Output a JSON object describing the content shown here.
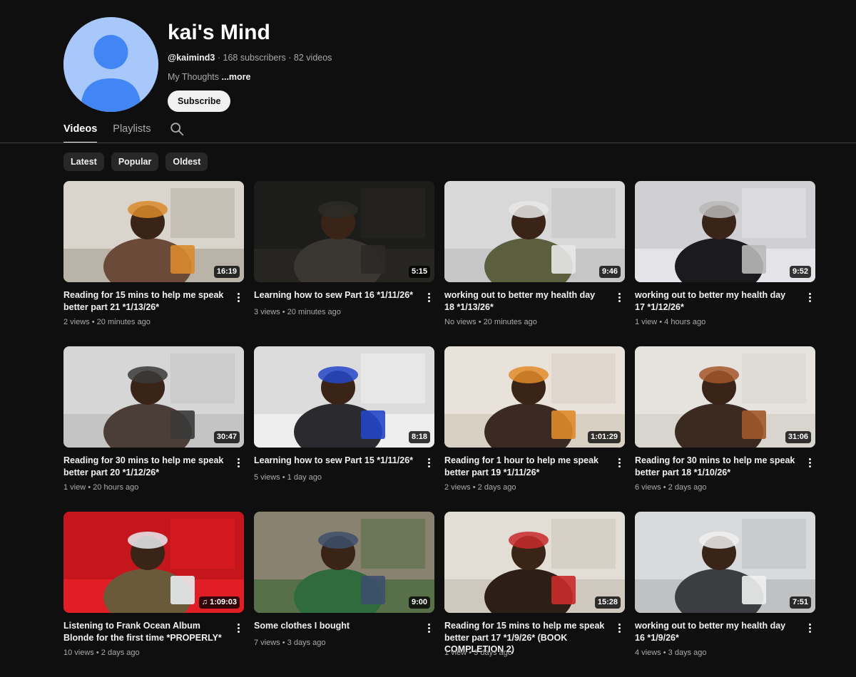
{
  "channel": {
    "title": "kai's Mind",
    "handle": "@kaimind3",
    "subscribers": "168 subscribers",
    "videos_count": "82 videos",
    "separator": "·",
    "description": "My Thoughts",
    "more_label": "...more",
    "subscribe_label": "Subscribe",
    "avatar_icon": "default-person-avatar",
    "avatar_bg": "#a8c7fa",
    "avatar_fg": "#4285f4"
  },
  "tabs": [
    {
      "label": "Videos",
      "active": true
    },
    {
      "label": "Playlists",
      "active": false
    }
  ],
  "search_icon": "search-icon",
  "chips": [
    "Latest",
    "Popular",
    "Oldest"
  ],
  "videos": [
    {
      "title": "Reading for 15 mins to help me speak better part 21 *1/13/26*",
      "duration": "16:19",
      "views": "2 views",
      "age": "20 minutes ago",
      "palette": [
        "#d9d4cc",
        "#b9b3a8",
        "#6b4a3a",
        "#d98a2b"
      ]
    },
    {
      "title": "Learning how to sew Part 16 *1/11/26*",
      "duration": "5:15",
      "views": "3 views",
      "age": "20 minutes ago",
      "palette": [
        "#1c1c1a",
        "#262522",
        "#3a3732",
        "#2c2a26"
      ]
    },
    {
      "title": "working out to better my health day 18 *1/13/26*",
      "duration": "9:46",
      "views": "No views",
      "age": "20 minutes ago",
      "palette": [
        "#d8d8d8",
        "#c6c6c6",
        "#5b5f3e",
        "#e8e8e8"
      ]
    },
    {
      "title": "working out to better my health day 17 *1/12/26*",
      "duration": "9:52",
      "views": "1 view",
      "age": "4 hours ago",
      "palette": [
        "#cfcfd4",
        "#e4e4e8",
        "#1b1b1e",
        "#b9b9b9"
      ]
    },
    {
      "title": "Reading for 30 mins to help me speak better part 20 *1/12/26*",
      "duration": "30:47",
      "views": "1 view",
      "age": "20 hours ago",
      "palette": [
        "#d6d6d6",
        "#c4c4c4",
        "#4b3e38",
        "#3a3a3a"
      ]
    },
    {
      "title": "Learning how to sew Part 15 *1/11/26*",
      "duration": "8:18",
      "views": "5 views",
      "age": "1 day ago",
      "palette": [
        "#dcdcdc",
        "#eeeeee",
        "#2b2b2f",
        "#2446c8"
      ]
    },
    {
      "title": "Reading for 1 hour to help me speak better part 19 *1/11/26*",
      "duration": "1:01:29",
      "views": "2 views",
      "age": "2 days ago",
      "palette": [
        "#e8e2da",
        "#d9d0c4",
        "#3a2a22",
        "#e08b2a"
      ]
    },
    {
      "title": "Reading for 30 mins to help me speak better part 18 *1/10/26*",
      "duration": "31:06",
      "views": "6 views",
      "age": "2 days ago",
      "palette": [
        "#e6e3df",
        "#d8d4ce",
        "#3b2a20",
        "#a2572a"
      ]
    },
    {
      "title": "Listening to Frank Ocean Album Blonde for the first time *PROPERLY*",
      "duration": "1:09:03",
      "views": "10 views",
      "age": "2 days ago",
      "palette": [
        "#c4161c",
        "#e11d25",
        "#6b5a3a",
        "#e9ecef"
      ],
      "music": true
    },
    {
      "title": "Some clothes I bought",
      "duration": "9:00",
      "views": "7 views",
      "age": "3 days ago",
      "palette": [
        "#8a8270",
        "#58704a",
        "#2f6b3c",
        "#3d4f6b"
      ]
    },
    {
      "title": "Reading for 15 mins to help me speak better part 17 *1/9/26* (BOOK COMPLETION 2)",
      "duration": "15:28",
      "views": "1 view",
      "age": "3 days ago",
      "palette": [
        "#e2ddd5",
        "#cfc8be",
        "#2e1e18",
        "#c82a2a"
      ]
    },
    {
      "title": "working out to better my health day 16 *1/9/26*",
      "duration": "7:51",
      "views": "4 views",
      "age": "3 days ago",
      "palette": [
        "#d9dadb",
        "#bfc1c3",
        "#3b3d40",
        "#efefef"
      ]
    }
  ]
}
